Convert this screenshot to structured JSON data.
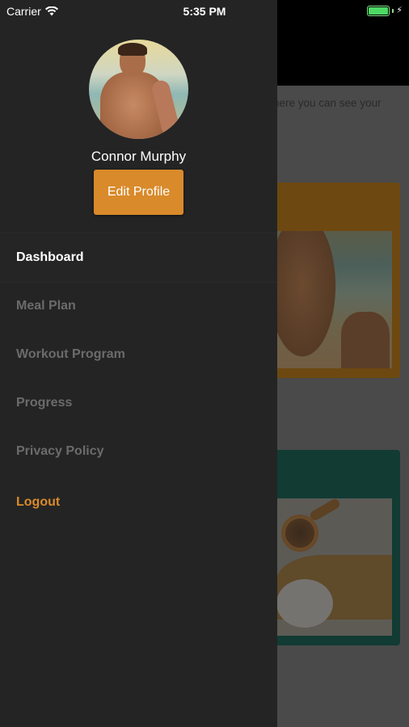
{
  "status_bar": {
    "carrier": "Carrier",
    "time": "5:35 PM",
    "wifi_icon": "wifi-icon",
    "battery_icon": "battery-full-icon",
    "charging_icon": "bolt-icon",
    "battery_color": "#4cd964"
  },
  "background": {
    "intro_text": "here you can see your",
    "card_colors": [
      "#6d4811",
      "#113b33"
    ]
  },
  "drawer": {
    "user_name": "Connor Murphy",
    "edit_profile_label": "Edit Profile",
    "accent_color": "#d98a2a",
    "menu": {
      "dashboard": "Dashboard",
      "meal_plan": "Meal Plan",
      "workout_program": "Workout Program",
      "progress": "Progress",
      "privacy_policy": "Privacy Policy",
      "logout": "Logout"
    },
    "active_item": "Dashboard"
  }
}
